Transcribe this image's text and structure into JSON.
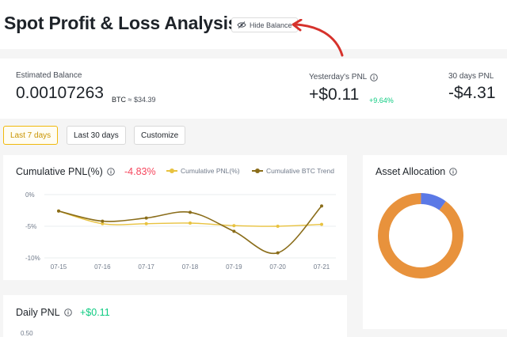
{
  "header": {
    "title": "Spot Profit & Loss Analysis",
    "hide_balance_label": "Hide Balance"
  },
  "balance": {
    "estimated_label": "Estimated Balance",
    "estimated_value": "0.00107263",
    "estimated_unit": "BTC",
    "estimated_usd": "≈ $34.39",
    "yesterday_label": "Yesterday's PNL",
    "yesterday_value": "+$0.11",
    "yesterday_pct": "+9.64%",
    "thirty_label": "30 days PNL",
    "thirty_value": "-$4.31"
  },
  "ranges": [
    "Last 7 days",
    "Last 30 days",
    "Customize"
  ],
  "active_range": "Last 7 days",
  "cumulative": {
    "title": "Cumulative PNL(%)",
    "value": "-4.83%",
    "legend_pnl": "Cumulative PNL(%)",
    "legend_btc": "Cumulative BTC Trend"
  },
  "allocation": {
    "title": "Asset Allocation"
  },
  "daily": {
    "title": "Daily PNL",
    "value": "+$0.11",
    "first_tick": "0.50"
  },
  "colors": {
    "pnl_line": "#e8c23f",
    "btc_line": "#8a6d1a",
    "negative": "#f6465d",
    "positive": "#0ecb81",
    "donut_orange": "#e8923c",
    "donut_blue": "#5b79e6",
    "arrow_red": "#d6322c"
  },
  "chart_data": {
    "type": "line",
    "x": [
      "07-15",
      "07-16",
      "07-17",
      "07-18",
      "07-19",
      "07-20",
      "07-21"
    ],
    "y_ticks": [
      "0%",
      "-5%",
      "-10%"
    ],
    "ylim": [
      -10,
      0
    ],
    "series": [
      {
        "name": "Cumulative PNL(%)",
        "values": [
          -2.6,
          -4.6,
          -4.6,
          -4.5,
          -4.9,
          -5.0,
          -4.7
        ]
      },
      {
        "name": "Cumulative BTC Trend",
        "values": [
          -2.6,
          -4.2,
          -3.7,
          -2.8,
          -5.8,
          -9.2,
          -1.8
        ]
      }
    ],
    "donut": [
      {
        "label": "",
        "value": 90
      },
      {
        "label": "",
        "value": 10
      }
    ]
  }
}
